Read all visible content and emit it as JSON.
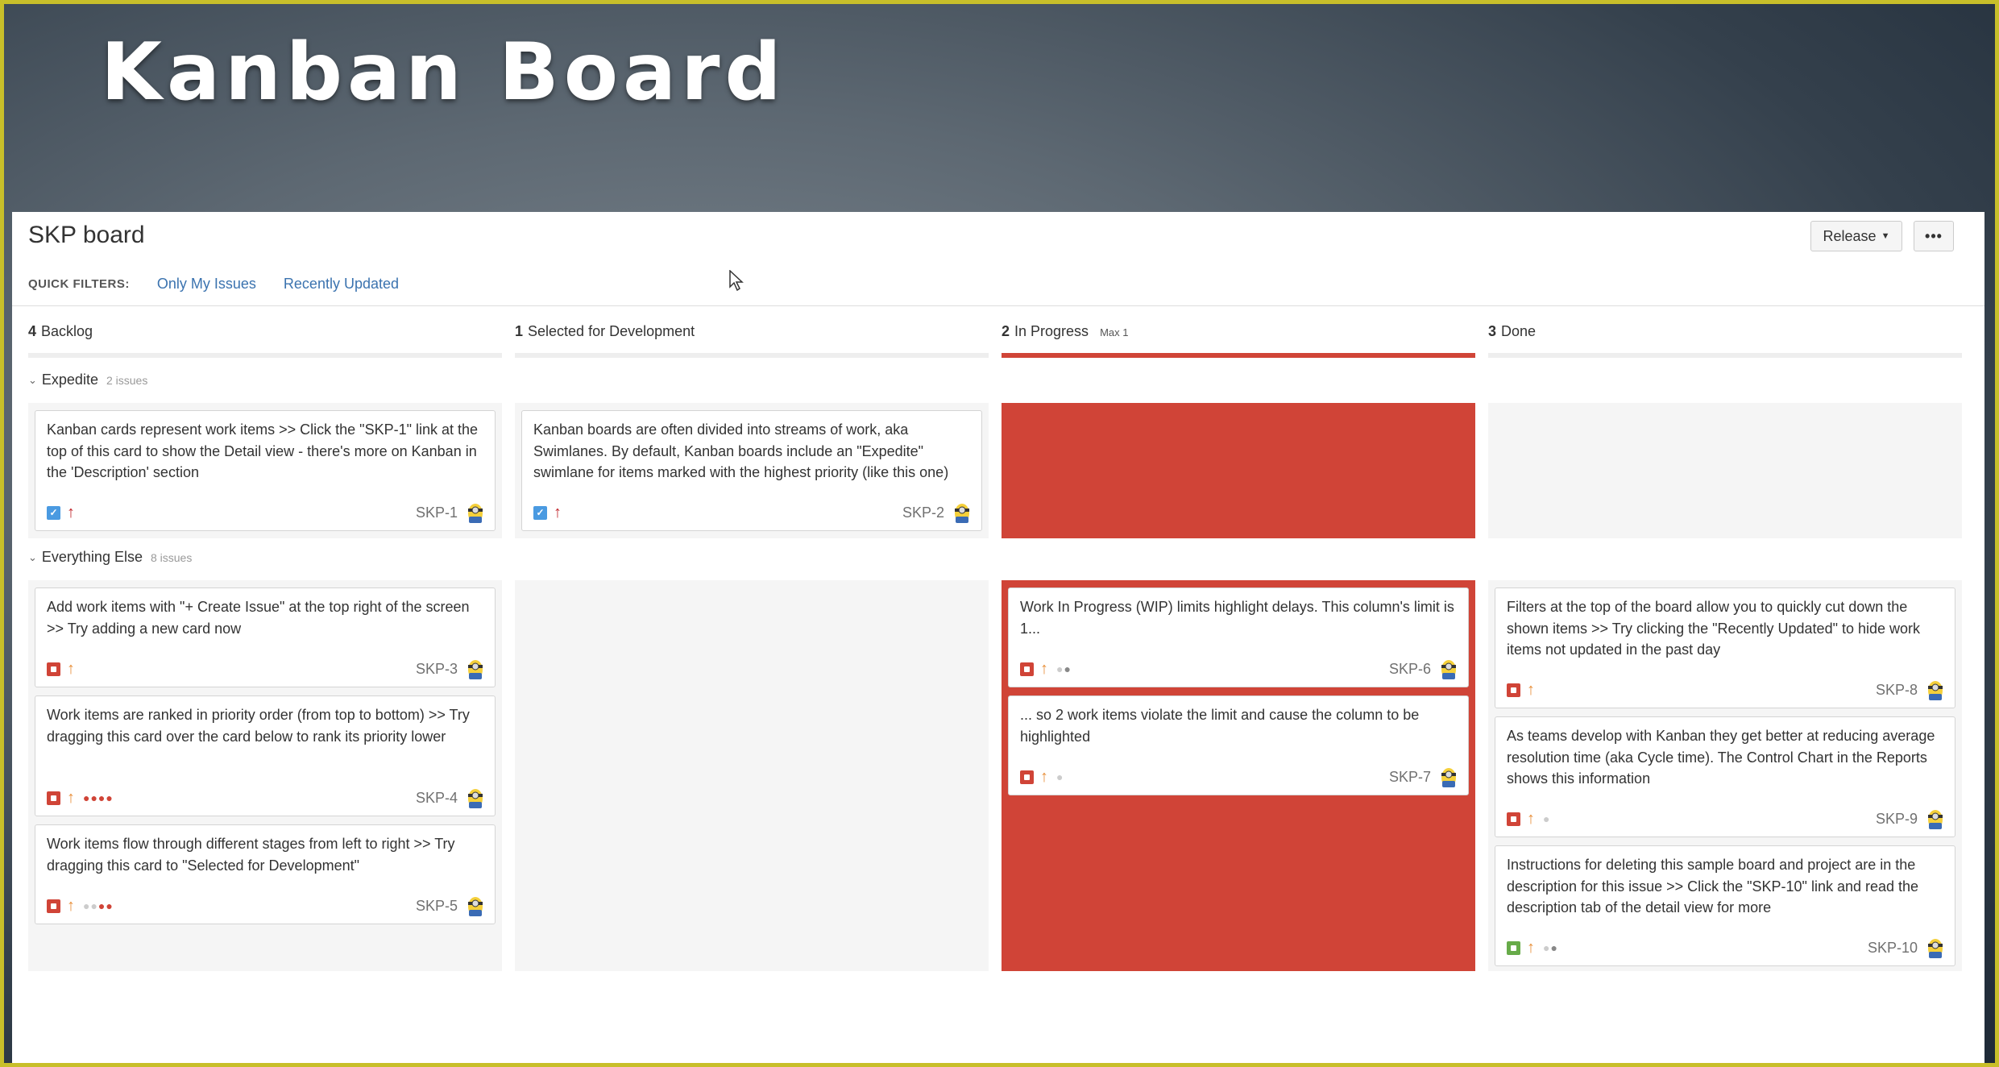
{
  "slide_title": "Kanban Board",
  "board": {
    "title": "SKP board",
    "quick_filters_label": "QUICK FILTERS:",
    "quick_filters": [
      "Only My Issues",
      "Recently Updated"
    ],
    "release_label": "Release",
    "more_label": "•••"
  },
  "columns": [
    {
      "count": "4",
      "name": "Backlog",
      "max": ""
    },
    {
      "count": "1",
      "name": "Selected for Development",
      "max": ""
    },
    {
      "count": "2",
      "name": "In Progress",
      "max": "Max 1"
    },
    {
      "count": "3",
      "name": "Done",
      "max": ""
    }
  ],
  "swimlanes": [
    {
      "name": "Expedite",
      "count": "2 issues"
    },
    {
      "name": "Everything Else",
      "count": "8 issues"
    }
  ],
  "cards": {
    "skp1": {
      "text": "Kanban cards represent work items >> Click the \"SKP-1\" link at the top of this card to show the Detail view - there's more on Kanban in the 'Description' section",
      "key": "SKP-1",
      "type": "task",
      "priority": "high"
    },
    "skp2": {
      "text": "Kanban boards are often divided into streams of work, aka Swimlanes. By default, Kanban boards include an \"Expedite\" swimlane for items marked with the highest priority (like this one)",
      "key": "SKP-2",
      "type": "task",
      "priority": "high"
    },
    "skp3": {
      "text": "Add work items with \"+ Create Issue\" at the top right of the screen >> Try adding a new card now",
      "key": "SKP-3",
      "type": "bug",
      "priority": "medium"
    },
    "skp4": {
      "text": "Work items are ranked in priority order (from top to bottom) >> Try dragging this card over the card below to rank its priority lower",
      "key": "SKP-4",
      "type": "bug",
      "priority": "medium"
    },
    "skp5": {
      "text": "Work items flow through different stages from left to right >> Try dragging this card to \"Selected for Development\"",
      "key": "SKP-5",
      "type": "bug",
      "priority": "medium"
    },
    "skp6": {
      "text": "Work In Progress (WIP) limits highlight delays. This column's limit is 1...",
      "key": "SKP-6",
      "type": "bug",
      "priority": "medium"
    },
    "skp7": {
      "text": "... so 2 work items violate the limit and cause the column to be highlighted",
      "key": "SKP-7",
      "type": "bug",
      "priority": "medium"
    },
    "skp8": {
      "text": "Filters at the top of the board allow you to quickly cut down the shown items >> Try clicking the \"Recently Updated\" to hide work items not updated in the past day",
      "key": "SKP-8",
      "type": "bug",
      "priority": "medium"
    },
    "skp9": {
      "text": "As teams develop with Kanban they get better at reducing average resolution time (aka Cycle time). The Control Chart in the Reports shows this information",
      "key": "SKP-9",
      "type": "bug",
      "priority": "medium"
    },
    "skp10": {
      "text": "Instructions for deleting this sample board and project are in the description for this issue >> Click the \"SKP-10\" link and read the description tab of the detail view for more",
      "key": "SKP-10",
      "type": "story",
      "priority": "medium"
    }
  },
  "colors": {
    "wip_exceeded": "#d04437",
    "link": "#3b73af",
    "frame_border": "#c8bf2a"
  }
}
